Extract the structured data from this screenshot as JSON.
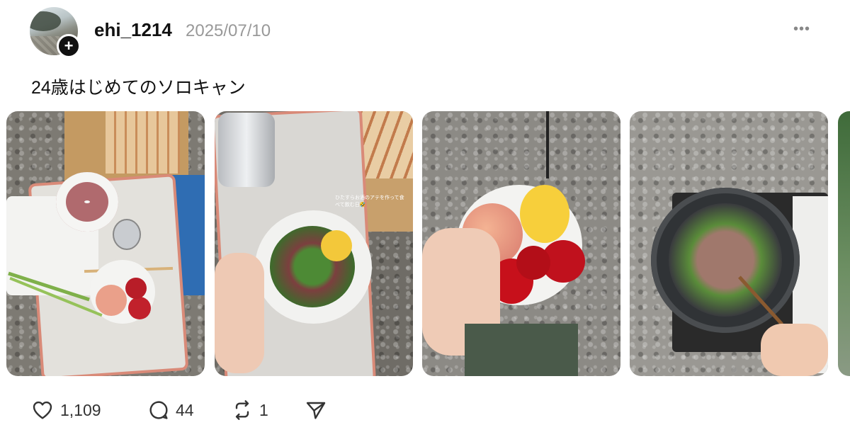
{
  "post": {
    "username": "ehi_1214",
    "date": "2025/07/10",
    "more_label": "•••",
    "follow_label": "+",
    "text": "24歳はじめてのソロキャン"
  },
  "photos": [
    {
      "subject": "camp table with squid, beer, peach, plums and chopsticks"
    },
    {
      "subject": "beer can and squid with green onion and lemon"
    },
    {
      "subject": "hand holding bowl with peach, lemon and plums"
    },
    {
      "subject": "frying pan with chicken and green onion on stove"
    }
  ],
  "photo2_caption": "ひたすらお酒のアテを作って食べて飲む日🤣",
  "actions": {
    "likes": "1,109",
    "replies": "44",
    "reposts": "1"
  },
  "icons": {
    "like": "heart-icon",
    "reply": "reply-icon",
    "repost": "repost-icon",
    "share": "share-icon",
    "more": "more-icon"
  }
}
